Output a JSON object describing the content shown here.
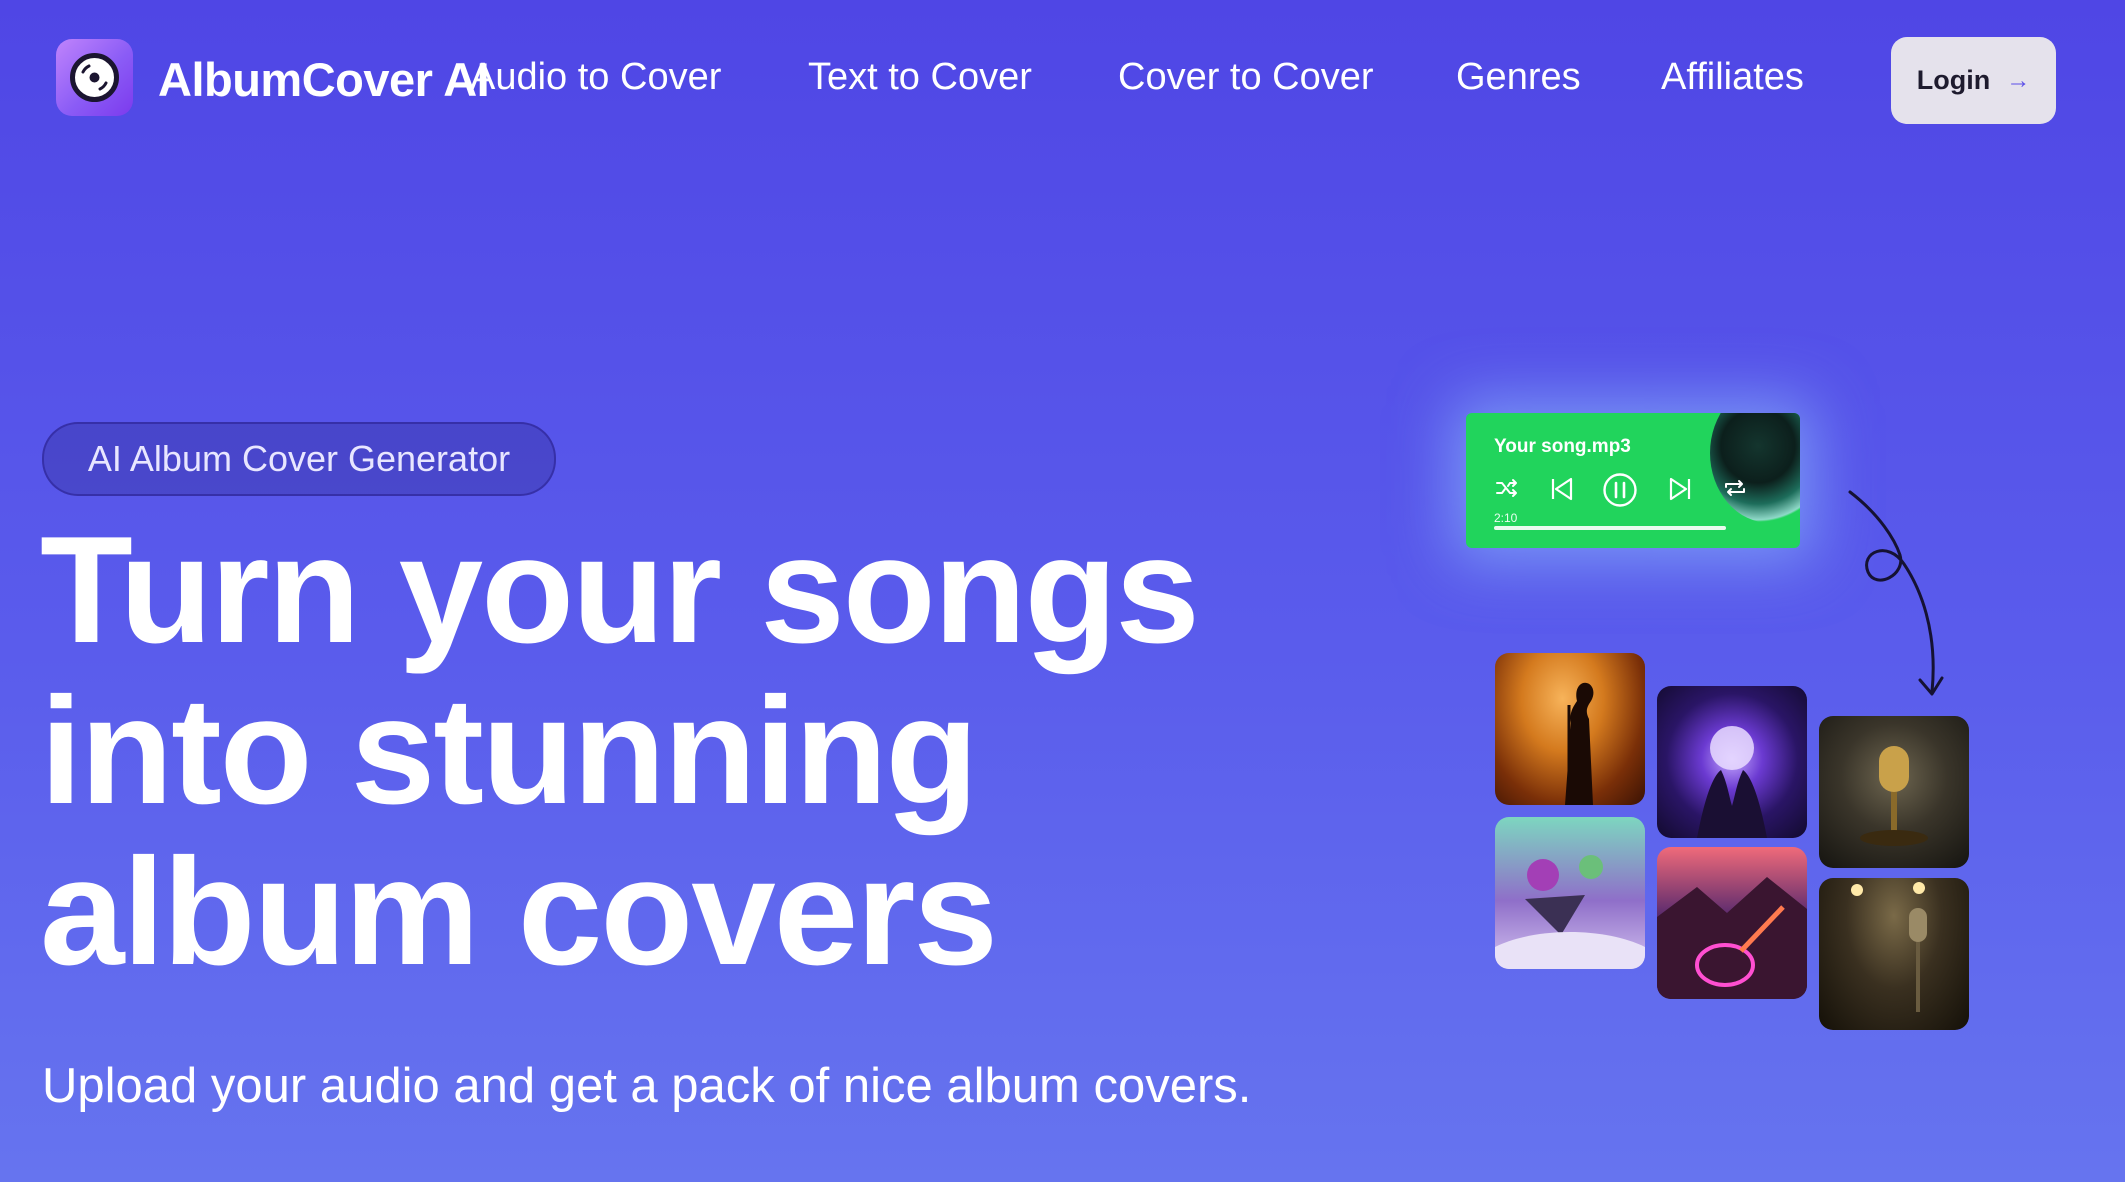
{
  "brand": {
    "name": "AlbumCover AI",
    "logo_icon": "vinyl-record-icon"
  },
  "nav": {
    "links": [
      "Audio to Cover",
      "Text to Cover",
      "Cover to Cover",
      "Genres",
      "Affiliates"
    ],
    "login_label": "Login",
    "login_icon": "arrow-right-icon"
  },
  "hero": {
    "badge": "AI Album Cover Generator",
    "headline_lines": [
      "Turn your songs",
      "into stunning",
      "album covers"
    ],
    "subtitle": "Upload your audio and get a pack of nice album covers."
  },
  "player": {
    "title": "Your song.mp3",
    "time": "2:10",
    "controls": [
      "shuffle-icon",
      "previous-icon",
      "pause-icon",
      "next-icon",
      "repeat-icon"
    ]
  },
  "covers": [
    "singer-silhouette-cover",
    "glowing-orb-hands-cover",
    "golden-microphone-cover",
    "floating-islands-cover",
    "neon-guitar-cover",
    "spotlight-microphone-cover"
  ],
  "colors": {
    "background_top": "#4f46e5",
    "background_bottom": "#6674ef",
    "player_green": "#21d45c",
    "login_bg": "#e5e2ec",
    "accent": "#5b4fe8"
  }
}
